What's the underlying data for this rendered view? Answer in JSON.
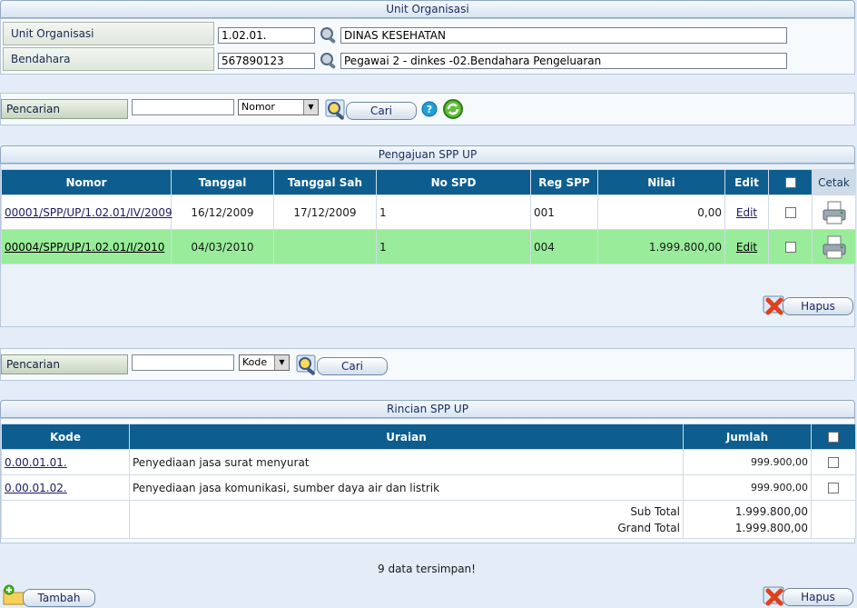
{
  "unit_section": {
    "title": "Unit Organisasi",
    "unit_label": "Unit Organisasi",
    "unit_code": "1.02.01.",
    "unit_name": "DINAS KESEHATAN",
    "bendahara_label": "Bendahara",
    "bendahara_code": "567890123",
    "bendahara_name": "Pegawai 2 - dinkes -02.Bendahara Pengeluaran"
  },
  "search1": {
    "label": "Pencarian",
    "value": "",
    "select_value": "Nomor",
    "button": "Cari"
  },
  "spp_section": {
    "title": "Pengajuan SPP UP",
    "columns": [
      "Nomor",
      "Tanggal",
      "Tanggal Sah",
      "No SPD",
      "Reg SPP",
      "Nilai",
      "Edit",
      "",
      "Cetak"
    ],
    "rows": [
      {
        "nomor": "00001/SPP/UP/1.02.01/IV/2009",
        "tanggal": "16/12/2009",
        "tanggal_sah": "17/12/2009",
        "no_spd": "1",
        "reg_spp": "001",
        "nilai": "0,00",
        "edit": "Edit"
      },
      {
        "nomor": "00004/SPP/UP/1.02.01/I/2010",
        "tanggal": "04/03/2010",
        "tanggal_sah": "",
        "no_spd": "1",
        "reg_spp": "004",
        "nilai": "1.999.800,00",
        "edit": "Edit"
      }
    ],
    "delete_button": "Hapus"
  },
  "search2": {
    "label": "Pencarian",
    "value": "",
    "select_value": "Kode",
    "button": "Cari"
  },
  "rincian_section": {
    "title": "Rincian SPP UP",
    "columns": [
      "Kode",
      "Uraian",
      "Jumlah",
      ""
    ],
    "rows": [
      {
        "kode": "0.00.01.01.",
        "uraian": "Penyediaan jasa surat menyurat",
        "jumlah": "999.900,00"
      },
      {
        "kode": "0.00.01.02.",
        "uraian": "Penyediaan jasa komunikasi, sumber daya air dan listrik",
        "jumlah": "999.900,00"
      }
    ],
    "subtotal_label": "Sub Total",
    "subtotal_value": "1.999.800,00",
    "grandtotal_label": "Grand Total",
    "grandtotal_value": "1.999.800,00"
  },
  "status_message": "9 data tersimpan!",
  "footer": {
    "add_button": "Tambah",
    "delete_button": "Hapus"
  },
  "colors": {
    "header_blue": "#0e5d8f",
    "highlight_green": "#99ec99",
    "background": "#e3ecf7"
  },
  "icons": [
    "magnifier-icon",
    "help-icon",
    "refresh-icon",
    "printer-icon",
    "delete-icon",
    "add-folder-icon"
  ]
}
